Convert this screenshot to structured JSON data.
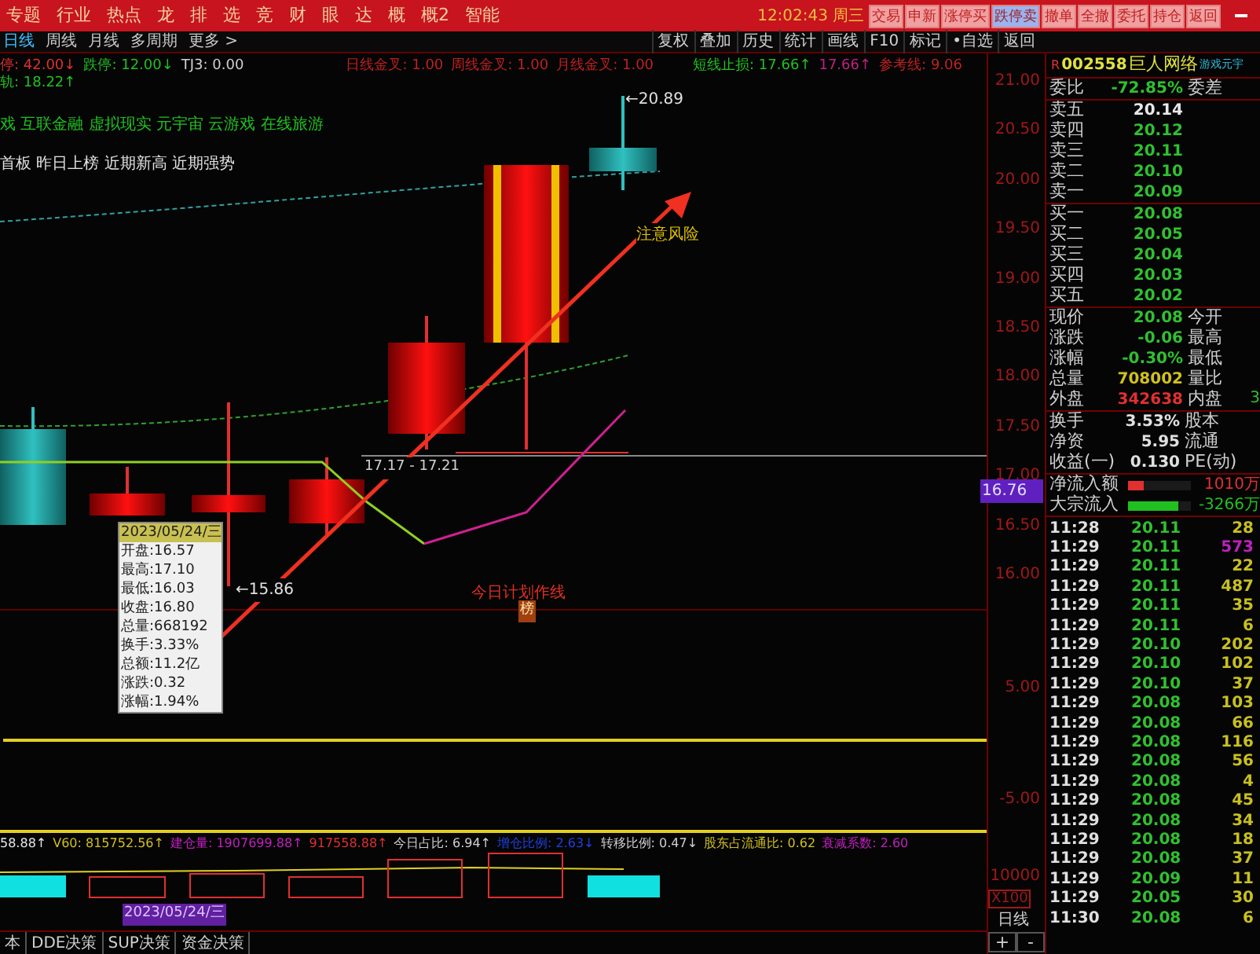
{
  "menu_bar": {
    "items": [
      "专题",
      "行业",
      "热点",
      "龙",
      "排",
      "选",
      "竞",
      "财",
      "眼",
      "达",
      "概",
      "概2",
      "智能"
    ],
    "clock": "12:02:43",
    "weekday": "周三"
  },
  "trade_buttons": [
    {
      "label": "交易",
      "selected": false
    },
    {
      "label": "申新",
      "selected": false
    },
    {
      "label": "涨停买",
      "selected": false
    },
    {
      "label": "跌停卖",
      "selected": true
    },
    {
      "label": "撤单",
      "selected": false
    },
    {
      "label": "全撤",
      "selected": false
    },
    {
      "label": "委托",
      "selected": false
    },
    {
      "label": "持仓",
      "selected": false
    },
    {
      "label": "返回",
      "selected": false
    }
  ],
  "period_tabs": [
    {
      "label": "日线",
      "selected": true
    },
    {
      "label": "周线",
      "selected": false
    },
    {
      "label": "月线",
      "selected": false
    },
    {
      "label": "多周期",
      "selected": false
    },
    {
      "label": "更多 >",
      "selected": false
    }
  ],
  "toolbar": [
    "复权",
    "叠加",
    "历史",
    "统计",
    "画线",
    "F10",
    "标记",
    "•自选",
    "返回"
  ],
  "indicator_row": [
    {
      "text": "停: 42.00↓",
      "color": "#e03030"
    },
    {
      "text": "跌停: 12.00↓",
      "color": "#20c020"
    },
    {
      "text": "TJ3: 0.00",
      "color": "#d0d0d0"
    },
    {
      "text": "日线金叉: 1.00",
      "color": "#c02020"
    },
    {
      "text": "周线金叉: 1.00",
      "color": "#c02020"
    },
    {
      "text": "月线金叉: 1.00",
      "color": "#c02020"
    },
    {
      "text": "短线止损: 17.66↑",
      "color": "#20c020"
    },
    {
      "text": "17.66↑",
      "color": "#c02080"
    },
    {
      "text": "参考线: 9.06",
      "color": "#c02020"
    }
  ],
  "indicator_row_2": {
    "text": "轨: 18.22↑",
    "color": "#20c020"
  },
  "concepts": "戏 互联金融 虚拟现实 元宇宙 云游戏 在线旅游",
  "tags": "首板 昨日上榜 近期新高 近期强势",
  "chart_labels": {
    "high": "←20.89",
    "risk": "注意风险",
    "range": "17.17 - 17.21",
    "low": "←15.86",
    "plan": "今日计划作线",
    "plan_tag": "榜"
  },
  "tooltip": {
    "date": "2023/05/24/三",
    "lines": [
      "开盘:16.57",
      "最高:17.10",
      "最低:16.03",
      "收盘:16.80",
      "总量:668192",
      "换手:3.33%",
      "总额:11.2亿",
      "涨跌:0.32",
      "涨幅:1.94%"
    ]
  },
  "price_axis": [
    "21.00",
    "20.50",
    "20.00",
    "19.50",
    "19.00",
    "18.50",
    "18.00",
    "17.50",
    "17.00",
    "16.50",
    "16.00"
  ],
  "current_price_tag": "16.76",
  "lower_axis": [
    "5.00",
    "-5.00",
    "10000"
  ],
  "axis_scale": "X100",
  "axis_period": "日线",
  "zoom_buttons": [
    "+",
    "-"
  ],
  "stock": {
    "flag": "R",
    "code": "002558",
    "name": "巨人网络",
    "concept": "游戏元宇"
  },
  "weibi": {
    "label": "委比",
    "value": "-72.85%",
    "label_2": "委差"
  },
  "sell_orders": [
    {
      "label": "卖五",
      "price": "20.14",
      "color": "#e8e8e8"
    },
    {
      "label": "卖四",
      "price": "20.12",
      "color": "#30c030"
    },
    {
      "label": "卖三",
      "price": "20.11",
      "color": "#30c030"
    },
    {
      "label": "卖二",
      "price": "20.10",
      "color": "#30c030"
    },
    {
      "label": "卖一",
      "price": "20.09",
      "color": "#30c030"
    }
  ],
  "buy_orders": [
    {
      "label": "买一",
      "price": "20.08",
      "color": "#30c030"
    },
    {
      "label": "买二",
      "price": "20.05",
      "color": "#30c030"
    },
    {
      "label": "买三",
      "price": "20.04",
      "color": "#30c030"
    },
    {
      "label": "买四",
      "price": "20.03",
      "color": "#30c030"
    },
    {
      "label": "买五",
      "price": "20.02",
      "color": "#30c030"
    }
  ],
  "quote": [
    {
      "label": "现价",
      "value": "20.08",
      "label_2": "今开",
      "color": "#30c030"
    },
    {
      "label": "涨跌",
      "value": "-0.06",
      "label_2": "最高",
      "color": "#30c030"
    },
    {
      "label": "涨幅",
      "value": "-0.30%",
      "label_2": "最低",
      "color": "#30c030"
    },
    {
      "label": "总量",
      "value": "708002",
      "label_2": "量比",
      "color": "#d0c020"
    },
    {
      "label": "外盘",
      "value": "342638",
      "label_2": "内盘",
      "color": "#e03030"
    }
  ],
  "quote_cut": "3",
  "finance": [
    {
      "label": "换手",
      "value": "3.53%",
      "label_2": "股本"
    },
    {
      "label": "净资",
      "value": "5.95",
      "label_2": "流通"
    },
    {
      "label": "收益(一)",
      "value": "0.130",
      "label_2": "PE(动)"
    }
  ],
  "flows": [
    {
      "label": "净流入额",
      "value": "1010万",
      "color": "#e03030",
      "level": 0.25
    },
    {
      "label": "大宗流入",
      "value": "-3266万",
      "color": "#20c020",
      "level": 0.8
    }
  ],
  "ticks": [
    {
      "time": "11:28",
      "price": "20.11",
      "volume": "28",
      "color": "#c8c020"
    },
    {
      "time": "11:29",
      "price": "20.11",
      "volume": "573",
      "color": "#c020c0"
    },
    {
      "time": "11:29",
      "price": "20.11",
      "volume": "22",
      "color": "#c8c020"
    },
    {
      "time": "11:29",
      "price": "20.11",
      "volume": "487",
      "color": "#c8c020"
    },
    {
      "time": "11:29",
      "price": "20.11",
      "volume": "35",
      "color": "#c8c020"
    },
    {
      "time": "11:29",
      "price": "20.11",
      "volume": "6",
      "color": "#c8c020"
    },
    {
      "time": "11:29",
      "price": "20.10",
      "volume": "202",
      "color": "#c8c020"
    },
    {
      "time": "11:29",
      "price": "20.10",
      "volume": "102",
      "color": "#c8c020"
    },
    {
      "time": "11:29",
      "price": "20.10",
      "volume": "37",
      "color": "#c8c020"
    },
    {
      "time": "11:29",
      "price": "20.08",
      "volume": "103",
      "color": "#c8c020"
    },
    {
      "time": "11:29",
      "price": "20.08",
      "volume": "66",
      "color": "#c8c020"
    },
    {
      "time": "11:29",
      "price": "20.08",
      "volume": "116",
      "color": "#c8c020"
    },
    {
      "time": "11:29",
      "price": "20.08",
      "volume": "56",
      "color": "#c8c020"
    },
    {
      "time": "11:29",
      "price": "20.08",
      "volume": "4",
      "color": "#c8c020"
    },
    {
      "time": "11:29",
      "price": "20.08",
      "volume": "45",
      "color": "#c8c020"
    },
    {
      "time": "11:29",
      "price": "20.08",
      "volume": "34",
      "color": "#c8c020"
    },
    {
      "time": "11:29",
      "price": "20.08",
      "volume": "18",
      "color": "#c8c020"
    },
    {
      "time": "11:29",
      "price": "20.08",
      "volume": "37",
      "color": "#c8c020"
    },
    {
      "time": "11:29",
      "price": "20.09",
      "volume": "11",
      "color": "#c8c020"
    },
    {
      "time": "11:29",
      "price": "20.05",
      "volume": "30",
      "color": "#c8c020"
    },
    {
      "time": "11:30",
      "price": "20.08",
      "volume": "6",
      "color": "#c8c020"
    }
  ],
  "lower_indicators": [
    {
      "text": "58.88↑",
      "color": "#e8e8e8"
    },
    {
      "text": "V60: 815752.56↑",
      "color": "#d0c020"
    },
    {
      "text": "建仓量: 1907699.88↑",
      "color": "#c020c0"
    },
    {
      "text": "917558.88↑",
      "color": "#e03030"
    },
    {
      "text": "今日占比: 6.94↑",
      "color": "#d0d0d0"
    },
    {
      "text": "增仓比例: 2.63↓",
      "color": "#2040e0"
    },
    {
      "text": "转移比例: 0.47↓",
      "color": "#d0d0d0"
    },
    {
      "text": "股东占流通比: 0.62",
      "color": "#d0c020"
    },
    {
      "text": "衰减系数: 2.60",
      "color": "#c020c0"
    }
  ],
  "volume_date": "2023/05/24/三",
  "bottom_tabs": [
    "本",
    "DDE决策",
    "SUP决策",
    "资金决策"
  ]
}
